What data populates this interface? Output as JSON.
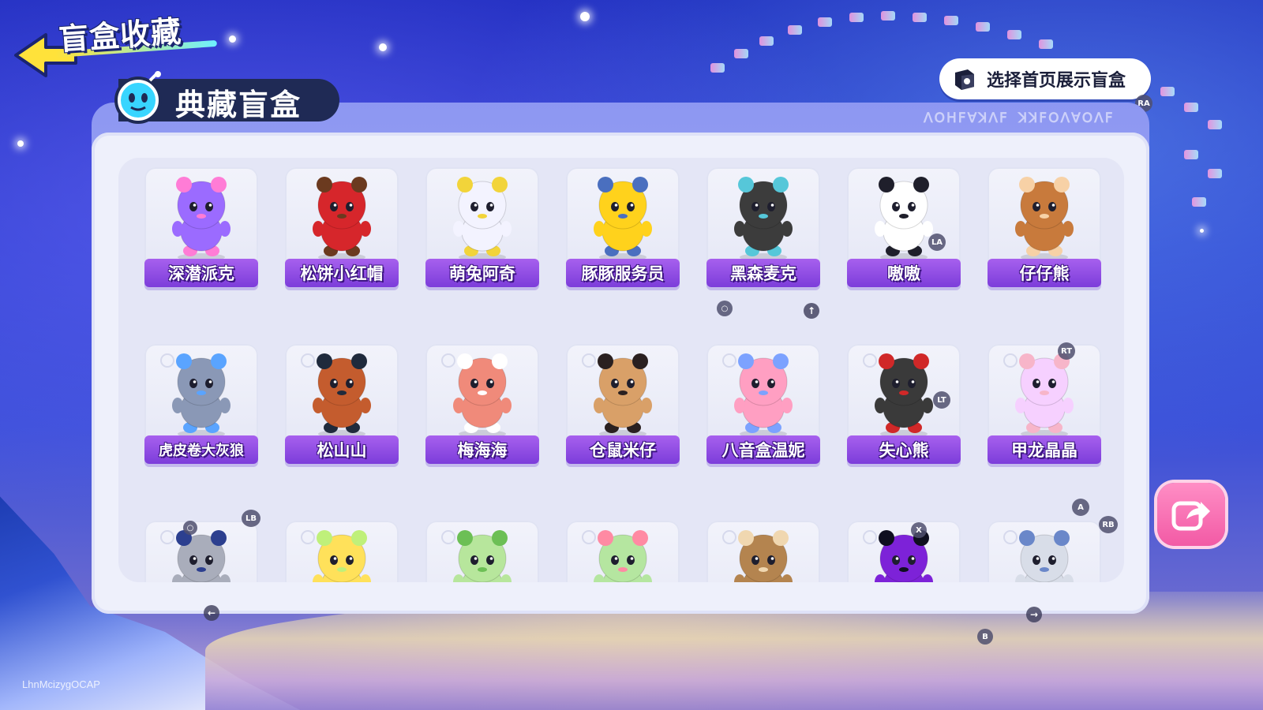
{
  "header": {
    "title": "盲盒收藏",
    "back_icon": "back-arrow-icon"
  },
  "section": {
    "title": "典藏盲盒",
    "icon": "mascot-icon"
  },
  "display_button": {
    "label": "选择首页展示盲盒",
    "icon": "box-icon",
    "hint": "RA"
  },
  "panel_deco_text": "ꓥꓳꓧꓝꓯꓘꓥꓝ ꓘꓘꓝꓳꓥꓯꓳꓥꓝ",
  "items": [
    {
      "name": "深潜派克",
      "color": "#9b6bff",
      "accent": "#ff7cd6"
    },
    {
      "name": "松饼小红帽",
      "color": "#d6262b",
      "accent": "#6b3a1f"
    },
    {
      "name": "萌兔阿奇",
      "color": "#f3f3ff",
      "accent": "#f2d43a"
    },
    {
      "name": "豚豚服务员",
      "color": "#ffd21c",
      "accent": "#4a6fbf"
    },
    {
      "name": "黑森麦克",
      "color": "#3c3c3c",
      "accent": "#56c7d9"
    },
    {
      "name": "嗷嗷",
      "color": "#ffffff",
      "accent": "#1f1f2b"
    },
    {
      "name": "仔仔熊",
      "color": "#c87a3c",
      "accent": "#f7d1a6"
    },
    {
      "name": "虎皮卷大灰狼",
      "color": "#8a98b6",
      "accent": "#5aa4ff"
    },
    {
      "name": "松山山",
      "color": "#c45c2e",
      "accent": "#1f2a3c"
    },
    {
      "name": "梅海海",
      "color": "#f08a7a",
      "accent": "#ffffff"
    },
    {
      "name": "仓鼠米仔",
      "color": "#d9a068",
      "accent": "#2a2020"
    },
    {
      "name": "八音盒温妮",
      "color": "#ff9fc2",
      "accent": "#7ca2ff"
    },
    {
      "name": "失心熊",
      "color": "#3a3a3a",
      "accent": "#d02828"
    },
    {
      "name": "甲龙晶晶",
      "color": "#f6d0ff",
      "accent": "#f7b5c9"
    },
    {
      "name": "",
      "color": "#a9adbb",
      "accent": "#2c3f8f"
    },
    {
      "name": "",
      "color": "#ffe15a",
      "accent": "#bff07a"
    },
    {
      "name": "",
      "color": "#b7e69c",
      "accent": "#6cbf55"
    },
    {
      "name": "",
      "color": "#b5e6a0",
      "accent": "#ff8aa3"
    },
    {
      "name": "",
      "color": "#b4844f",
      "accent": "#f0d7b0"
    },
    {
      "name": "",
      "color": "#7d22d8",
      "accent": "#0f0f1f"
    },
    {
      "name": "",
      "color": "#d8dde8",
      "accent": "#6a87c9"
    }
  ],
  "controller_hints": {
    "la": "LA",
    "lt": "LT",
    "rt": "RT",
    "lb": "LB",
    "rb": "RB",
    "a": "A",
    "x": "X",
    "b": "B",
    "o": "○"
  },
  "nav": {
    "prev_icon": "arrow-left-icon",
    "next_icon": "arrow-right-icon",
    "up_icon": "arrow-up-icon"
  },
  "share_button": {
    "icon": "share-icon"
  },
  "player_id": "LhnMcizygOCAP"
}
